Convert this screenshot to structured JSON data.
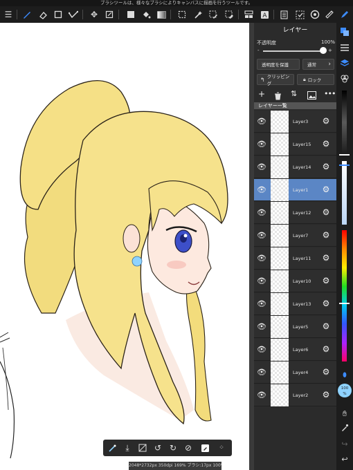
{
  "status_bar": {
    "text": "ブラシツールは、様々なブラシによりキャンバスに描画を行うツールです。"
  },
  "toolbar": {
    "menu_icon": "menu-icon",
    "tools": [
      "brush-tool-icon",
      "eraser-tool-icon",
      "fill-rect-icon",
      "shape-icon",
      "move-icon",
      "transform-icon",
      "fill-color-icon",
      "bucket-icon",
      "gradation-icon",
      "select-rect-icon",
      "magic-wand-icon",
      "select-pen-icon",
      "select-eraser-icon",
      "layer-panel-icon",
      "text-icon",
      "frame-icon",
      "material-icon",
      "reference-icon",
      "ruler-icon",
      "pen-icon"
    ]
  },
  "layer_panel": {
    "title": "レイヤー",
    "opacity_label": "不透明度",
    "opacity_value": "100%",
    "opacity_fraction": 1.0,
    "minus": "-",
    "plus": "+",
    "protect_alpha": "透明度を保護",
    "blend_mode": "通常",
    "clipping": "クリッピング",
    "lock": "ロック",
    "list_header": "レイヤー一覧",
    "layers": [
      {
        "name": "Layer3",
        "selected": false
      },
      {
        "name": "Layer15",
        "selected": false
      },
      {
        "name": "Layer14",
        "selected": false
      },
      {
        "name": "Layer1",
        "selected": true
      },
      {
        "name": "Layer12",
        "selected": false
      },
      {
        "name": "Layer7",
        "selected": false
      },
      {
        "name": "Layer11",
        "selected": false
      },
      {
        "name": "Layer10",
        "selected": false
      },
      {
        "name": "Layer13",
        "selected": false
      },
      {
        "name": "Layer5",
        "selected": false
      },
      {
        "name": "Layer6",
        "selected": false
      },
      {
        "name": "Layer4",
        "selected": false
      },
      {
        "name": "Layer2",
        "selected": false
      }
    ]
  },
  "right_strip": {
    "brush_size_label": "100",
    "brush_size_unit": "%",
    "colors": {
      "accent": "#3d8cff",
      "brush_circle": "#8fd3ff"
    }
  },
  "canvas_info": "2048*2732px 350dpi 169% ブラシ:17px 100%"
}
